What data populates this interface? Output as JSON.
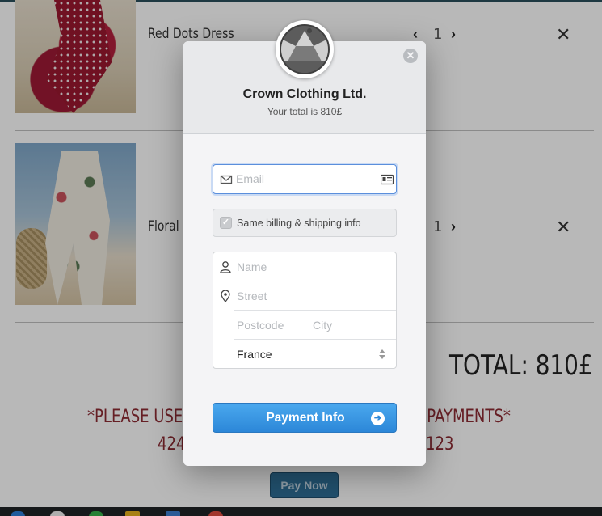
{
  "cart": {
    "items": [
      {
        "name": "Red Dots Dress",
        "quantity": "1"
      },
      {
        "name": "Floral D",
        "quantity": "1"
      }
    ],
    "decrement_icon": "‹",
    "increment_icon": "›",
    "remove_icon": "✕",
    "total": "TOTAL: 810£",
    "notice_line1_left": "*PLEASE USE T",
    "notice_line1_right": "R PAYMENTS*",
    "notice_line2_left": "424",
    "notice_line2_right": "123",
    "pay_now_label": "Pay Now"
  },
  "modal": {
    "store_name": "Crown Clothing Ltd.",
    "total_text": "Your total is 810£",
    "close_icon": "✕",
    "email_placeholder": "Email",
    "same_info_label": "Same billing & shipping info",
    "same_info_checked": true,
    "name_placeholder": "Name",
    "street_placeholder": "Street",
    "postcode_placeholder": "Postcode",
    "city_placeholder": "City",
    "country_value": "France",
    "submit_label": "Payment Info",
    "submit_arrow_icon": "➔",
    "accent_color": "#2c87d8"
  },
  "icons": {
    "email": "envelope-icon",
    "card": "id-card-icon",
    "name": "person-icon",
    "street": "map-pin-icon",
    "checkbox": "check-icon",
    "select": "select-arrows-icon",
    "close": "close-icon",
    "arrow": "arrow-right-icon"
  }
}
